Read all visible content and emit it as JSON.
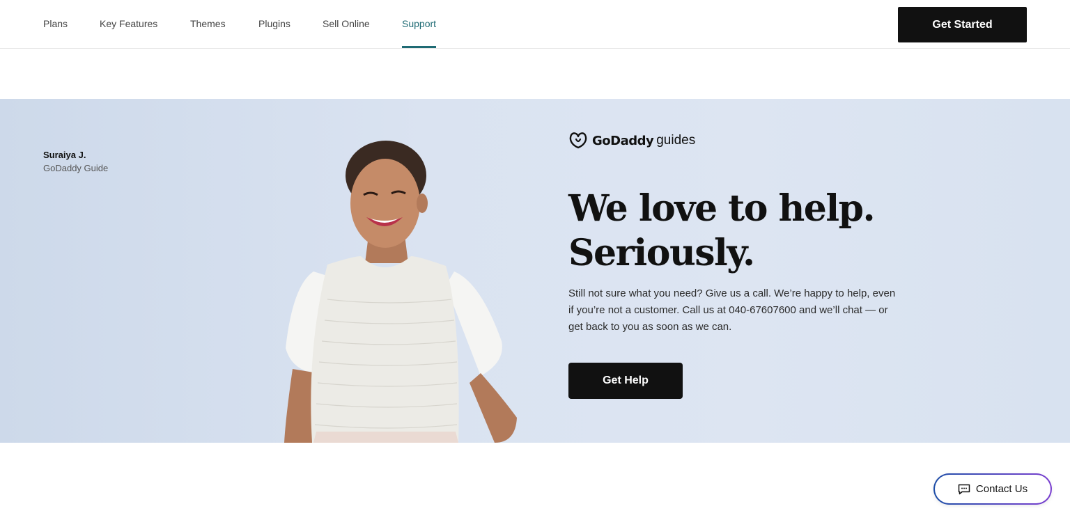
{
  "nav": {
    "items": [
      {
        "label": "Plans"
      },
      {
        "label": "Key Features"
      },
      {
        "label": "Themes"
      },
      {
        "label": "Plugins"
      },
      {
        "label": "Sell Online"
      },
      {
        "label": "Support",
        "active": true
      }
    ],
    "cta_label": "Get Started"
  },
  "hero": {
    "guide_name": "Suraiya J.",
    "guide_role": "GoDaddy Guide",
    "brand_name": "GoDaddy",
    "brand_suffix": "guides",
    "headline_line1": "We love to help.",
    "headline_line2": "Seriously.",
    "body": "Still not sure what you need? Give us a call. We’re happy to help, even if you’re not a customer. Call us at 040-67607600 and we’ll chat — or get back to you as soon as we can.",
    "cta_label": "Get Help"
  },
  "contact": {
    "label": "Contact Us",
    "icon": "chat-icon"
  },
  "colors": {
    "accent": "#1f6b74",
    "button_dark": "#111111",
    "hero_bg": "#dae3f1",
    "contact_border_start": "#1f4fa8",
    "contact_border_end": "#7a3fd0"
  }
}
